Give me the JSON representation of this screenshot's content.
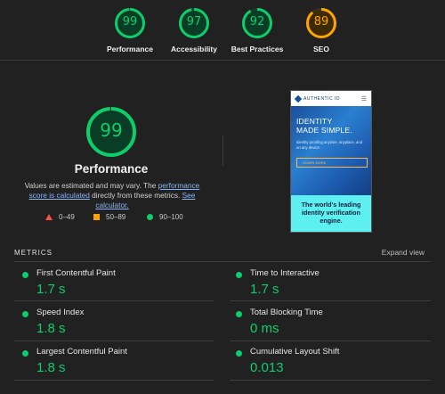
{
  "categories": [
    {
      "label": "Performance",
      "score": "99",
      "value": 99,
      "color": "#0cce6b"
    },
    {
      "label": "Accessibility",
      "score": "97",
      "value": 97,
      "color": "#0cce6b"
    },
    {
      "label": "Best Practices",
      "score": "92",
      "value": 92,
      "color": "#0cce6b"
    },
    {
      "label": "SEO",
      "score": "89",
      "value": 89,
      "color": "#ffa400"
    }
  ],
  "performance": {
    "score": "99",
    "value": 99,
    "title": "Performance",
    "desc_prefix": "Values are estimated and may vary. The ",
    "desc_link1": "performance score is calculated",
    "desc_middle": " directly from these metrics. ",
    "desc_link2": "See calculator.",
    "legend": {
      "fail": "0–49",
      "average": "50–89",
      "pass": "90–100"
    }
  },
  "screenshot": {
    "brand": "AUTHENTIC ID",
    "menu_glyph": "☰",
    "headline_1": "IDENTITY",
    "headline_2": "MADE SIMPLE.",
    "body": "Identity proofing anytime, anyplace, and on any device.",
    "button": "LEARN MORE",
    "band_1": "The world's leading",
    "band_2": "identity verification",
    "band_3": "engine."
  },
  "metrics": {
    "header": "METRICS",
    "expand": "Expand view",
    "items": [
      {
        "name": "First Contentful Paint",
        "value": "1.7 s"
      },
      {
        "name": "Time to Interactive",
        "value": "1.7 s"
      },
      {
        "name": "Speed Index",
        "value": "1.8 s"
      },
      {
        "name": "Total Blocking Time",
        "value": "0 ms"
      },
      {
        "name": "Largest Contentful Paint",
        "value": "1.8 s"
      },
      {
        "name": "Cumulative Layout Shift",
        "value": "0.013"
      }
    ]
  },
  "colors": {
    "pass": "#0cce6b",
    "average": "#ffa400",
    "fail": "#ff4e42",
    "link": "#8ab4f8"
  }
}
